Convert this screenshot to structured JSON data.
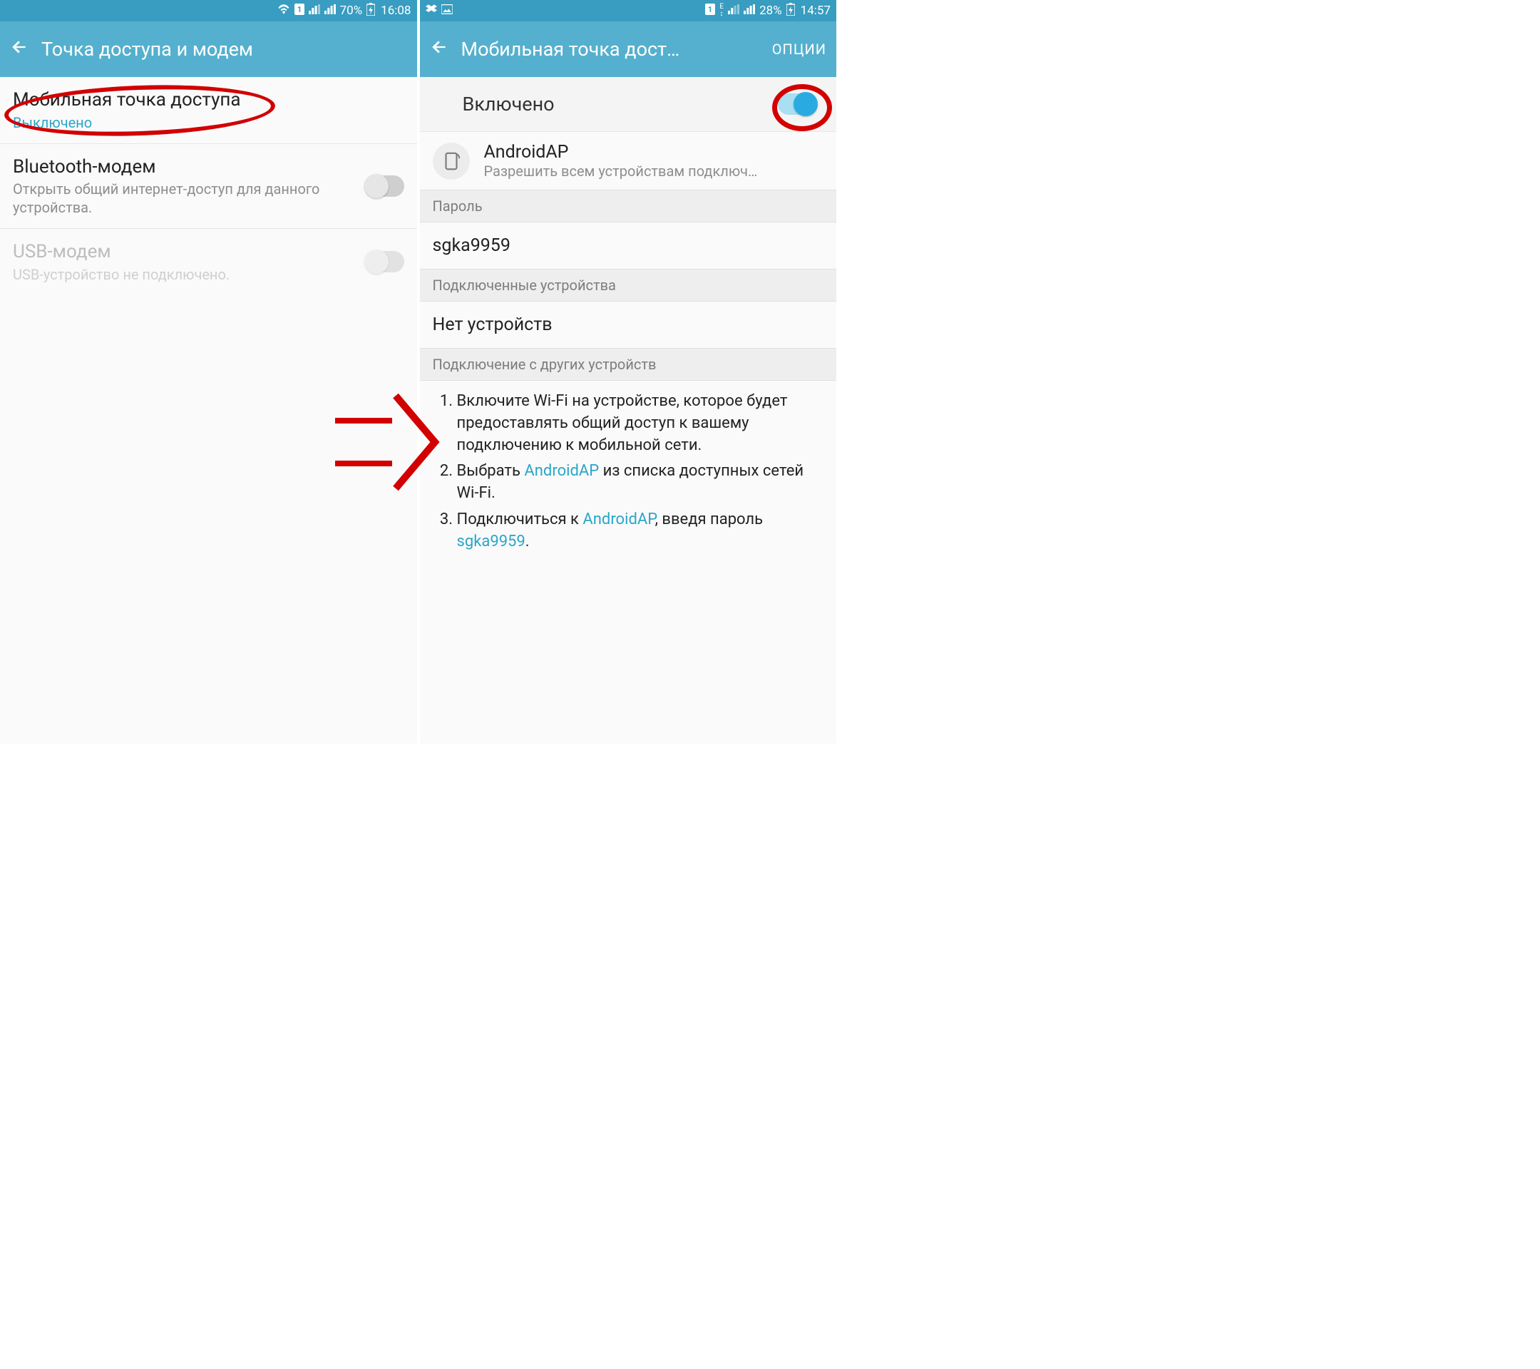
{
  "left": {
    "status": {
      "battery": "70%",
      "time": "16:08"
    },
    "appbar": {
      "title": "Точка доступа и модем"
    },
    "items": {
      "hotspot": {
        "title": "Мобильная точка доступа",
        "sub": "Выключено"
      },
      "bt": {
        "title": "Bluetooth-модем",
        "sub": "Открыть общий интернет-доступ для данного устройства."
      },
      "usb": {
        "title": "USB-модем",
        "sub": "USB-устройство не подключено."
      }
    }
  },
  "right": {
    "status": {
      "battery": "28%",
      "time": "14:57"
    },
    "appbar": {
      "title": "Мобильная точка дост…",
      "action": "ОПЦИИ"
    },
    "enabled_label": "Включено",
    "hotspot": {
      "name": "AndroidAP",
      "desc": "Разрешить всем устройствам подключ…"
    },
    "sections": {
      "password": "Пароль",
      "connected": "Подключенные устройства",
      "howto": "Подключение с других устройств"
    },
    "password_value": "sgka9959",
    "no_devices": "Нет устройств",
    "instructions": {
      "step1": "Включите Wi-Fi на устройстве, которое будет предоставлять общий доступ к вашему подключению к мобильной сети.",
      "step2_a": "Выбрать ",
      "step2_link": "AndroidAP",
      "step2_b": " из списка доступных сетей Wi-Fi.",
      "step3_a": "Подключиться к ",
      "step3_link1": "AndroidAP",
      "step3_b": ", введя пароль ",
      "step3_link2": "sgka9959",
      "step3_c": "."
    }
  }
}
